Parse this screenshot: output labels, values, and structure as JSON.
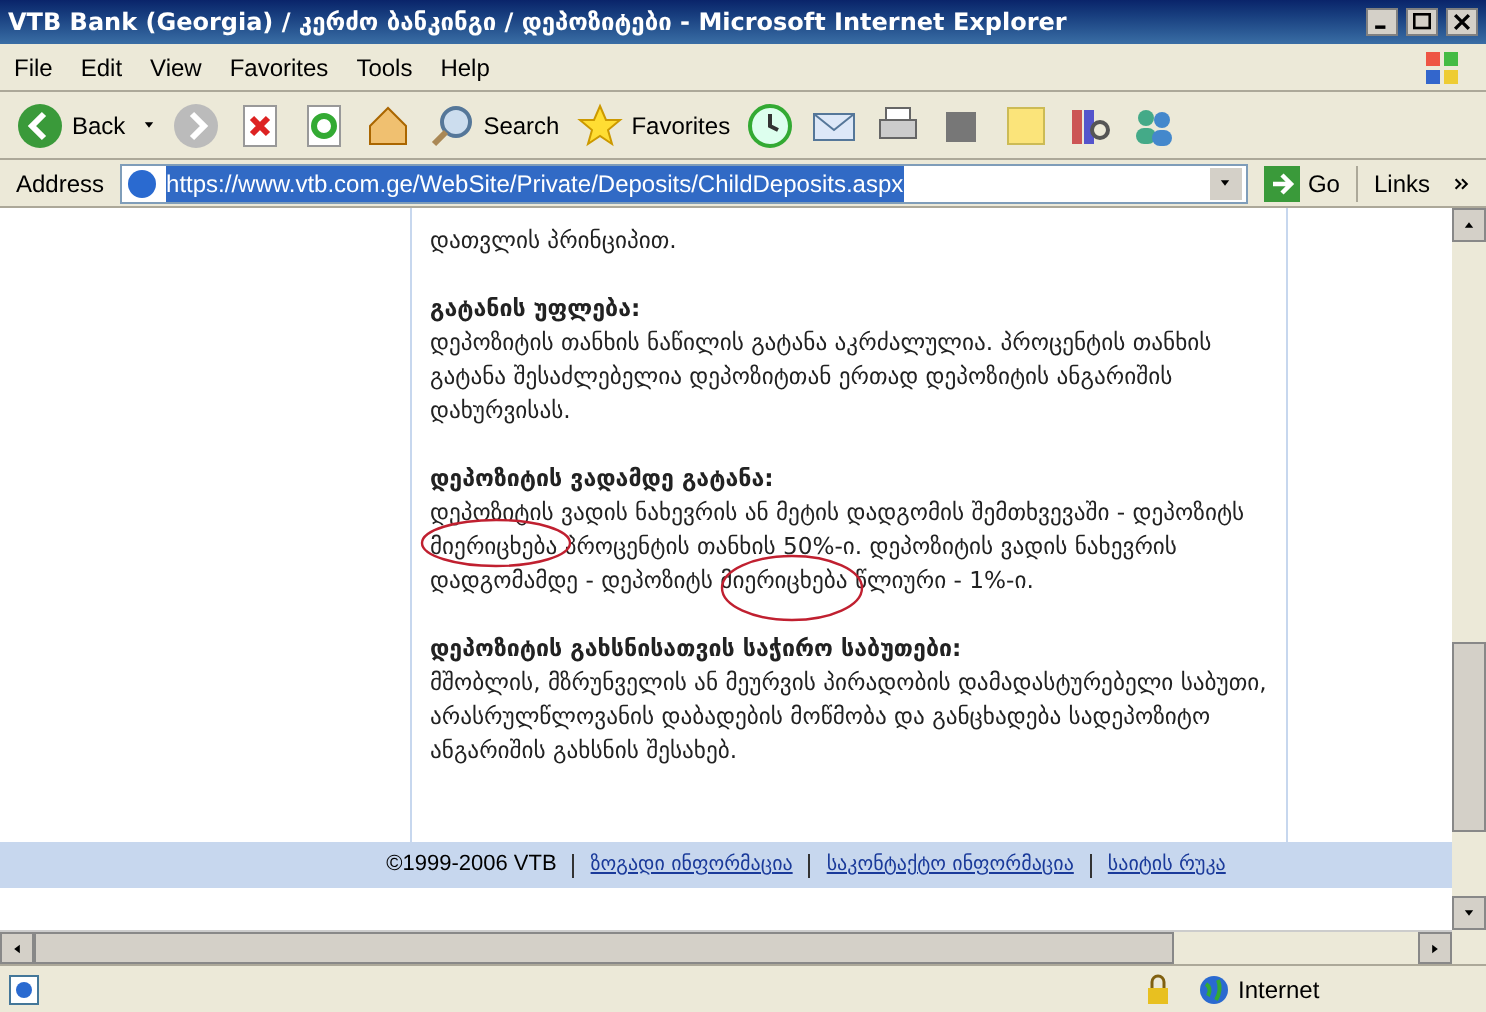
{
  "window": {
    "title": "VTB Bank (Georgia) / კერძო ბანკინგი / დეპოზიტები - Microsoft Internet Explorer"
  },
  "menu": [
    "File",
    "Edit",
    "View",
    "Favorites",
    "Tools",
    "Help"
  ],
  "toolbar": {
    "back": "Back",
    "search": "Search",
    "favorites": "Favorites"
  },
  "address": {
    "label": "Address",
    "url": "https://www.vtb.com.ge/WebSite/Private/Deposits/ChildDeposits.aspx",
    "go": "Go",
    "links": "Links"
  },
  "content": {
    "lead": "დათვლის პრინციპით.",
    "sections": [
      {
        "heading": "გატანის უფლება:",
        "body": "დეპოზიტის თანხის ნაწილის გატანა აკრძალულია. პროცენტის თანხის გატანა შესაძლებელია დეპოზიტთან ერთად დეპოზიტის ანგარიშის დახურვისას."
      },
      {
        "heading": "დეპოზიტის ვადამდე გატანა:",
        "body": "დეპოზიტის ვადის ნახევრის ან მეტის დადგომის შემთხვევაში - დეპოზიტს მიერიცხება პროცენტის თანხის 50%-ი. დეპოზიტის ვადის ნახევრის დადგომამდე - დეპოზიტს მიერიცხება წლიური - 1%-ი.",
        "annotated": true
      },
      {
        "heading": "დეპოზიტის გახსნისათვის საჭირო საბუთები:",
        "body": "მშობლის, მზრუნველის ან მეურვის პირადობის დამადასტურებელი საბუთი, არასრულწლოვანის დაბადების მოწმობა და განცხადება სადეპოზიტო ანგარიშის გახსნის შესახებ."
      }
    ]
  },
  "footer": {
    "copyright": "©1999-2006 VTB",
    "links": [
      "ზოგადი ინფორმაცია",
      "საკონტაქტო ინფორმაცია",
      "საიტის რუკა"
    ]
  },
  "status_bar": {
    "zone": "Internet"
  }
}
